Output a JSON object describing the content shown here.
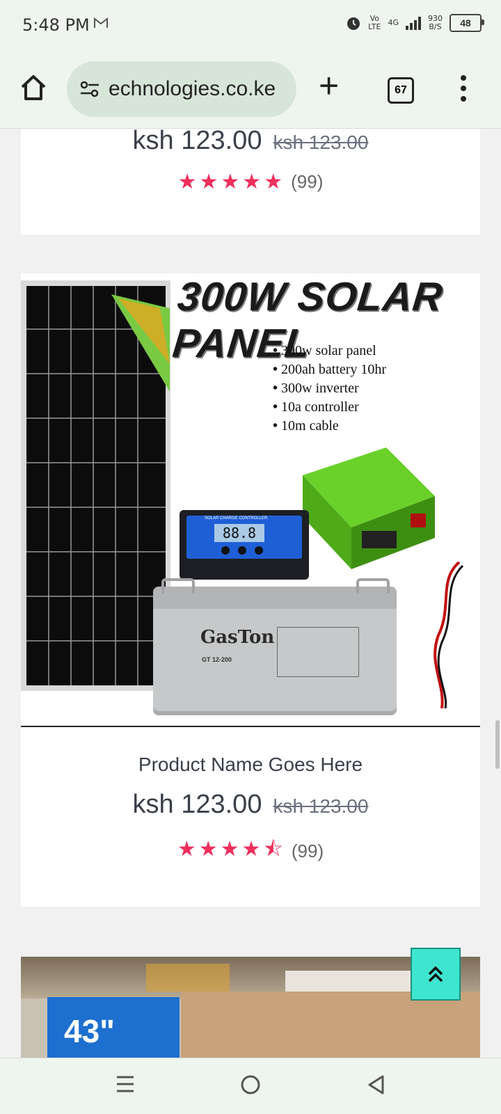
{
  "status_bar": {
    "time": "5:48 PM",
    "mail_icon": "gmail-icon",
    "volte_top": "Vo",
    "volte_bottom": "LTE",
    "network": "4G",
    "speed_value": "930",
    "speed_unit": "B/S",
    "battery": "48"
  },
  "browser": {
    "url": "echnologies.co.ke",
    "tab_count": "67"
  },
  "products": [
    {
      "price": "ksh 123.00",
      "old_price": "ksh 123.00",
      "rating": 5,
      "stars": "★★★★★",
      "review_count": "(99)"
    },
    {
      "image_title": "300W SOLAR PANEL",
      "features": [
        "300w solar panel",
        "200ah battery 10hr",
        "300w inverter",
        "10a controller",
        "10m cable"
      ],
      "controller_label": "SOLAR CHARGE CONTROLLER",
      "controller_display": "88.8",
      "battery_brand": "GasTon",
      "battery_model": "GT 12-200",
      "name": "Product Name Goes Here",
      "price": "ksh 123.00",
      "old_price": "ksh 123.00",
      "rating": 4.5,
      "stars": "★★★★⯪",
      "review_count": "(99)"
    },
    {
      "image_badge": "43\""
    }
  ],
  "colors": {
    "star": "#ee2f5c",
    "back_to_top": "#3fe6cf",
    "chrome_bg": "#eef5ee"
  }
}
